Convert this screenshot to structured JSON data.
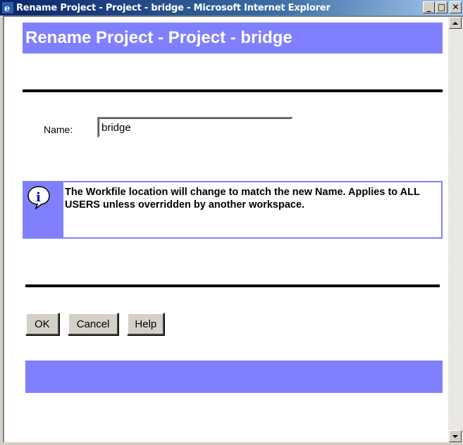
{
  "window": {
    "title": "Rename Project - Project - bridge - Microsoft Internet Explorer",
    "minimize_glyph": "_",
    "maximize_glyph": "□",
    "close_glyph": "✕"
  },
  "dialog": {
    "heading": "Rename Project - Project - bridge",
    "name_label": "Name:",
    "name_value": "bridge",
    "info_message": "The Workfile location will change to match the new Name. Applies to ALL USERS unless overridden by another workspace.",
    "info_icon": "info-icon"
  },
  "buttons": {
    "ok": "OK",
    "cancel": "Cancel",
    "help": "Help"
  },
  "colors": {
    "accent": "#8080ff",
    "rule": "#000000",
    "chrome": "#d4d0c8"
  }
}
